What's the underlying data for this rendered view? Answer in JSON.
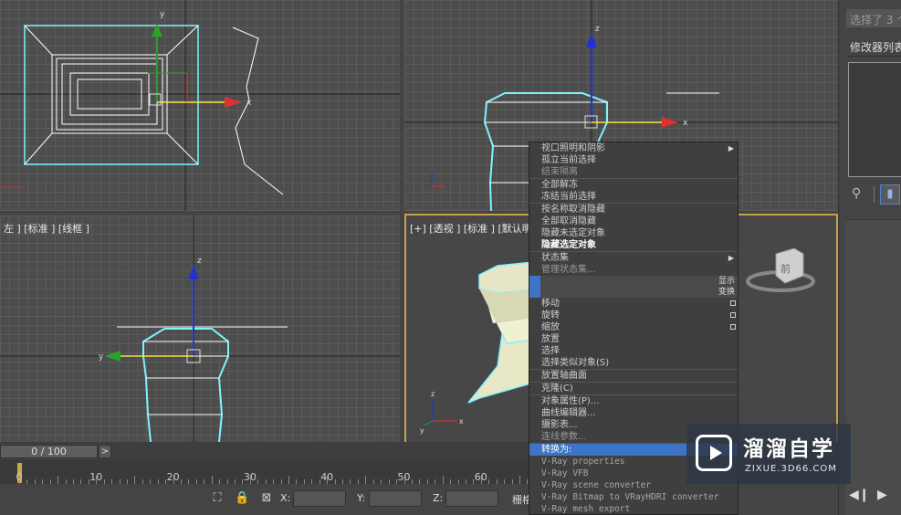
{
  "viewports": {
    "left_label": "左 ] [标准 ] [线框 ]",
    "perspective_label": "[+] [透视 ] [标准 ] [默认明"
  },
  "panel": {
    "selection_text": "选择了 3 个",
    "modifier_list": "修改器列表"
  },
  "timeline": {
    "frame_display": "0 / 100",
    "next_symbol": ">",
    "ruler_labels": [
      "0",
      "10",
      "20",
      "30",
      "40",
      "50",
      "60"
    ]
  },
  "status": {
    "x_label": "X:",
    "y_label": "Y:",
    "z_label": "Z:",
    "grid_label": "栅格"
  },
  "menu": {
    "g1": [
      "视口照明和阴影",
      "孤立当前选择",
      "结束隔离"
    ],
    "g2": [
      "全部解冻",
      "冻结当前选择"
    ],
    "g3": [
      "按名称取消隐藏",
      "全部取消隐藏",
      "隐藏未选定对象",
      "隐藏选定对象"
    ],
    "g4": [
      "状态集",
      "管理状态集..."
    ],
    "quad_display": "显示",
    "quad_transform": "变换",
    "g5": [
      "移动",
      "旋转",
      "缩放",
      "放置",
      "选择",
      "选择类似对象(S)"
    ],
    "g6": [
      "放置轴曲面"
    ],
    "g7": [
      "克隆(C)"
    ],
    "g8": [
      "对象属性(P)...",
      "曲线编辑器...",
      "摄影表...",
      "连线参数..."
    ],
    "g9": [
      "转换为:"
    ],
    "vray": [
      "V-Ray properties",
      "V-Ray VFB",
      "V-Ray scene converter",
      "V-Ray Bitmap to VRayHDRI converter",
      "V-Ray mesh export"
    ]
  },
  "viewcube_label": "前",
  "watermark": {
    "title": "溜溜自学",
    "subtitle": "ZIXUE.3D66.COM"
  },
  "colors": {
    "selection_cyan": "#7ef3ff",
    "active_border": "#c9a14a",
    "menu_highlight": "#3d74c6"
  }
}
